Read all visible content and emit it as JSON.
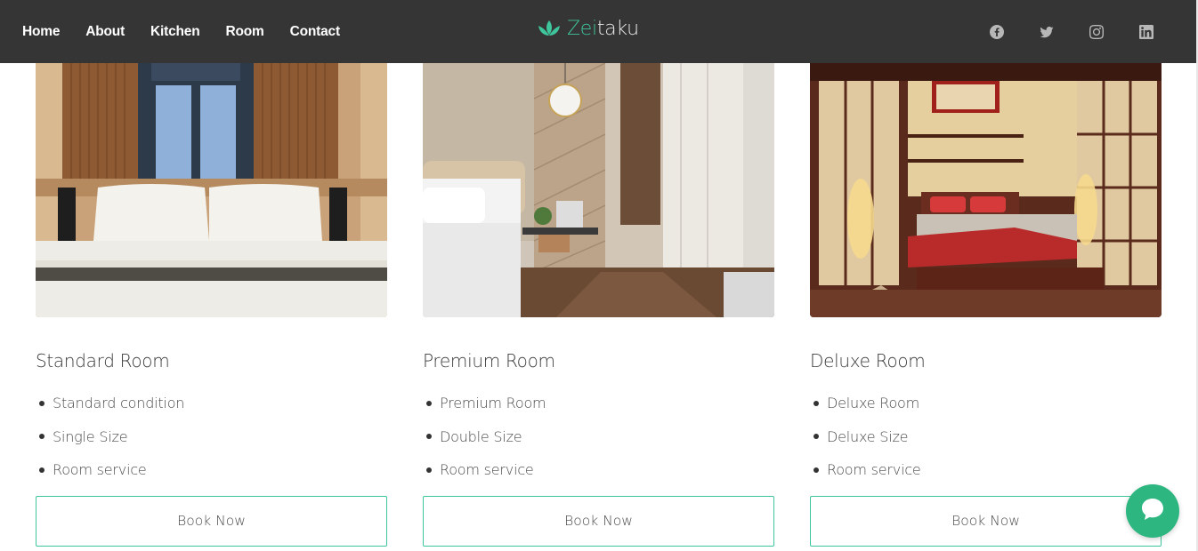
{
  "nav": {
    "links": [
      "Home",
      "About",
      "Kitchen",
      "Room",
      "Contact"
    ],
    "brand_prefix": "Zei",
    "brand_suffix": "taku",
    "brand_icon": "lotus-icon",
    "socials": [
      "facebook-icon",
      "twitter-icon",
      "instagram-icon",
      "linkedin-icon"
    ]
  },
  "colors": {
    "navbar": "#353535",
    "accent": "#3ec59b",
    "chat": "#2db680"
  },
  "rooms": [
    {
      "title": "Standard Room",
      "features": [
        "Standard condition",
        "Single Size",
        "Room service"
      ],
      "button": "Book Now"
    },
    {
      "title": "Premium Room",
      "features": [
        "Premium Room",
        "Double Size",
        "Room service"
      ],
      "button": "Book Now"
    },
    {
      "title": "Deluxe Room",
      "features": [
        "Deluxe Room",
        "Deluxe Size",
        "Room service"
      ],
      "button": "Book Now"
    }
  ],
  "chat": {
    "icon": "chat-bubble-icon"
  }
}
